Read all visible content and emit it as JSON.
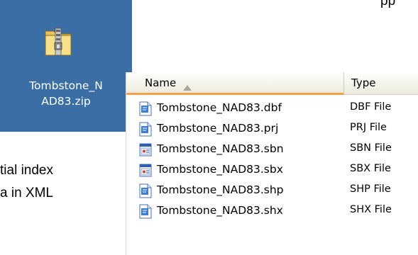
{
  "page_text": {
    "top_right_fragment": "pp",
    "line1_fragment": "tial index",
    "line2_fragment": "a in XML"
  },
  "desktop": {
    "background": "#3a6ea5",
    "zip_icon": "zip-folder-icon",
    "label_line1": "Tombstone_N",
    "label_line2": "AD83.zip"
  },
  "explorer": {
    "columns": {
      "name": "Name",
      "type": "Type",
      "sort_icon": "sort-ascending-icon",
      "sorted_column_accent": "#f3a14a"
    },
    "files": [
      {
        "name": "Tombstone_NAD83.dbf",
        "type": "DBF File",
        "icon": "document-icon"
      },
      {
        "name": "Tombstone_NAD83.prj",
        "type": "PRJ File",
        "icon": "document-icon"
      },
      {
        "name": "Tombstone_NAD83.sbn",
        "type": "SBN File",
        "icon": "application-file-icon"
      },
      {
        "name": "Tombstone_NAD83.sbx",
        "type": "SBX File",
        "icon": "application-file-icon"
      },
      {
        "name": "Tombstone_NAD83.shp",
        "type": "SHP File",
        "icon": "document-icon"
      },
      {
        "name": "Tombstone_NAD83.shx",
        "type": "SHX File",
        "icon": "document-icon"
      }
    ]
  }
}
